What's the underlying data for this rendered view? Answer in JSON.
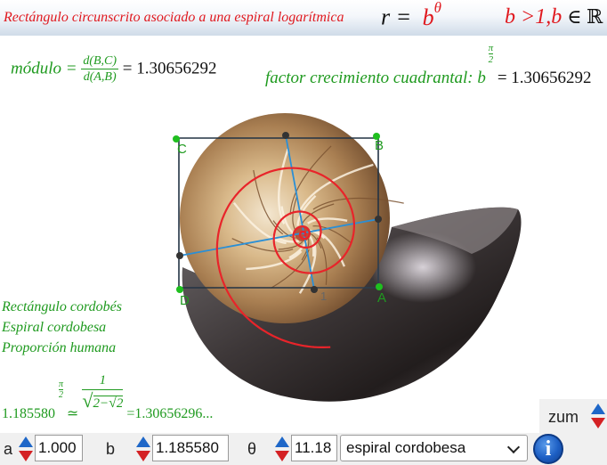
{
  "header": {
    "title": "Rectángulo circunscrito asociado a una espiral logarítmica",
    "formula_lhs": "r =",
    "formula_base": "b",
    "formula_exp": "θ",
    "condition": "b >1,",
    "condition_b": "b",
    "condition_in": "∈ ℝ"
  },
  "formulas": {
    "modulo_label": "módulo =",
    "modulo_num": "d(B,C)",
    "modulo_den": "d(A,B)",
    "modulo_value": "= 1.30656292",
    "factor_label": "factor crecimiento cuadrantal:",
    "factor_base": "b",
    "factor_exp_num": "π",
    "factor_exp_den": "2",
    "factor_value": "= 1.30656292"
  },
  "notes": {
    "line1": "Rectángulo cordobés",
    "line2": "Espiral cordobesa",
    "line3": "Proporción humana",
    "ratio_base": "1.185580",
    "ratio_exp_num": "π",
    "ratio_exp_den": "2",
    "ratio_approx": "≃",
    "ratio_num": "1",
    "ratio_den_pre": "2−",
    "ratio_den_inner": "2",
    "ratio_value": "=1.30656296..."
  },
  "points": {
    "A": "A",
    "B": "B",
    "C": "C",
    "D": "D",
    "O": "1"
  },
  "controls": {
    "zoom_label": "zum",
    "a_label": "a",
    "a_value": "1.000",
    "b_label": "b",
    "b_value": "1.185580",
    "theta_label": "θ",
    "theta_value": "11.18",
    "curve_select": "espiral cordobesa",
    "info_glyph": "i"
  },
  "colors": {
    "green": "#1f9a1f",
    "red": "#e0191f",
    "spiral": "#e8242a",
    "diagonal": "#2a8fd6",
    "rect": "#223344",
    "spin_up": "#1e67c8",
    "spin_down": "#d42124"
  },
  "icons": [
    "spin-up-icon",
    "spin-down-icon",
    "chevron-down-icon",
    "info-icon"
  ]
}
